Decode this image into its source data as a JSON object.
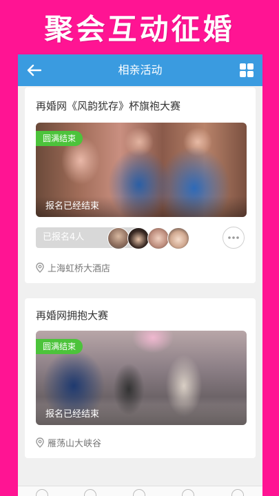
{
  "banner": {
    "title": "聚会互动征婚"
  },
  "header": {
    "title": "相亲活动"
  },
  "events": [
    {
      "title": "再婚网《风韵犹存》杯旗袍大赛",
      "status": "圆满结束",
      "overlay": "报名已经结束",
      "registered": "已报名4人",
      "location": "上海虹桥大酒店"
    },
    {
      "title": "再婚网拥抱大赛",
      "status": "圆满结束",
      "overlay": "报名已经结束",
      "location": "雁荡山大峡谷"
    }
  ],
  "icons": {
    "back": "back-arrow-icon",
    "menu": "grid-icon",
    "more": "more-icon",
    "location": "location-pin-icon"
  },
  "colors": {
    "banner_bg": "#ff1493",
    "header_bg": "#3a9be0",
    "status_tag": "#4cc33b"
  }
}
